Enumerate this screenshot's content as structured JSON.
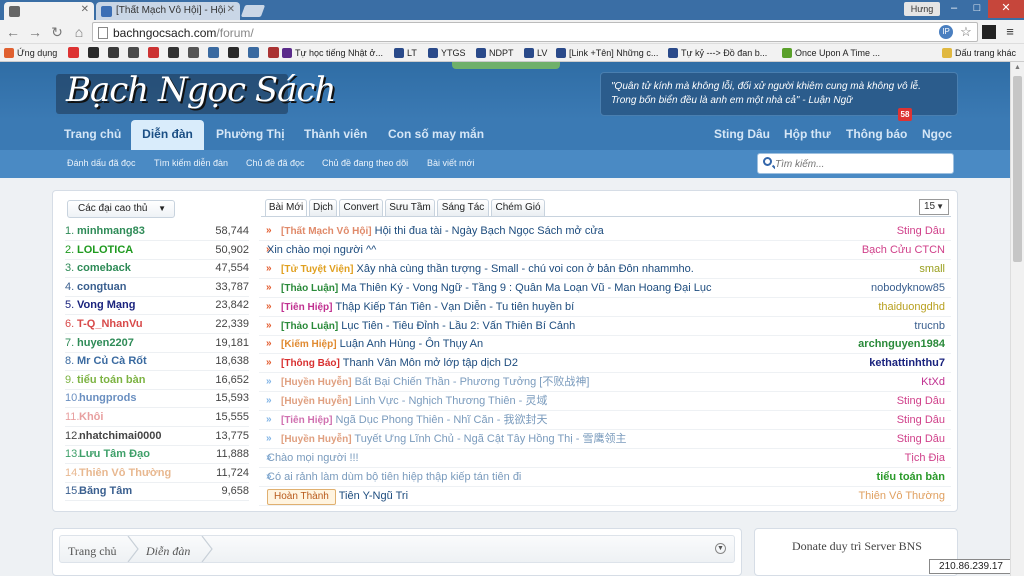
{
  "browser": {
    "tabs": [
      {
        "label": "",
        "active": true
      },
      {
        "label": "[Thất Mạch Vô Hội] - Hội",
        "active": false
      }
    ],
    "user": "Hưng",
    "url_domain": "bachngocsach.com",
    "url_path": "/forum/",
    "bookmarks": [
      "Ứng dụng",
      "Tự học tiếng Nhật ở...",
      "LT",
      "YTGS",
      "NDPT",
      "LV",
      "[Link +Tên] Những c...",
      "Tự kỷ ---> Đồ đan b...",
      "Once Upon A Time ...",
      "Dấu trang khác"
    ]
  },
  "site": {
    "logo": "Bạch Ngọc Sách",
    "quote_line1": "\"Quân tử kính mà không lỗi, đối xử người khiêm cung mà không vô lễ.",
    "quote_line2": "Trong bốn biển đều là anh em một nhà cả\" - Luận Ngữ",
    "nav_left": [
      "Trang chủ",
      "Diễn đàn",
      "Phường Thị",
      "Thành viên",
      "Con số may mắn"
    ],
    "nav_right": [
      "Sting Dâu",
      "Hộp thư",
      "Thông báo",
      "Ngọc"
    ],
    "notification_count": "58",
    "subnav": [
      "Đánh dấu đã đọc",
      "Tìm kiếm diễn đàn",
      "Chủ đề đã đọc",
      "Chủ đề đang theo dõi",
      "Bài viết mới"
    ],
    "search_placeholder": "Tìm kiếm..."
  },
  "leaderboard": {
    "dropdown": "Các đại cao thủ",
    "entries": [
      {
        "rank": "1.",
        "name": "minhmang83",
        "points": "58,744",
        "color": "#2e8b57"
      },
      {
        "rank": "2.",
        "name": "LOLOTICA",
        "points": "50,902",
        "color": "#1f9a1f"
      },
      {
        "rank": "3.",
        "name": "comeback",
        "points": "47,554",
        "color": "#2e8b57"
      },
      {
        "rank": "4.",
        "name": "congtuan",
        "points": "33,787",
        "color": "#3a5f8f"
      },
      {
        "rank": "5.",
        "name": "Vong Mạng",
        "points": "23,842",
        "color": "#1a237e"
      },
      {
        "rank": "6.",
        "name": "T-Q_NhanVu",
        "points": "22,339",
        "color": "#d84a4a"
      },
      {
        "rank": "7.",
        "name": "huyen2207",
        "points": "19,181",
        "color": "#2e8b57"
      },
      {
        "rank": "8.",
        "name": "Mr Củ Cà Rốt",
        "points": "18,638",
        "color": "#3a6aa0"
      },
      {
        "rank": "9.",
        "name": "tiểu toán bàn",
        "points": "16,652",
        "color": "#7cb342"
      },
      {
        "rank": "10.",
        "name": "hungprods",
        "points": "15,593",
        "color": "#6a8fc0"
      },
      {
        "rank": "11.",
        "name": "Khôi",
        "points": "15,555",
        "color": "#e8a0a0"
      },
      {
        "rank": "12.",
        "name": "nhatchimai0000",
        "points": "13,775",
        "color": "#444444"
      },
      {
        "rank": "13.",
        "name": "Lưu Tâm Đạo",
        "points": "11,888",
        "color": "#3fa06a"
      },
      {
        "rank": "14.",
        "name": "Thiên Vô Thường",
        "points": "11,724",
        "color": "#e8b890"
      },
      {
        "rank": "15.",
        "name": "Băng Tâm",
        "points": "9,658",
        "color": "#3a5f8f"
      }
    ]
  },
  "topics": {
    "tabs": [
      "Bài Mới",
      "Dịch",
      "Convert",
      "Sưu Tầm",
      "Sáng Tác",
      "Chém Gió"
    ],
    "page_size": "15",
    "rows": [
      {
        "cat": "[Thất Mạch Vô Hội]",
        "cat_color": "#e08a6a",
        "title": "Hội thi đua tài - Ngày Bạch Ngọc Sách mở cửa",
        "user": "Sting Dâu",
        "user_color": "#d0408a",
        "fade": false,
        "tag": ""
      },
      {
        "cat": "",
        "cat_color": "",
        "title": "Xin chào mọi người ^^",
        "user": "Bạch Cửu CTCN",
        "user_color": "#d0408a",
        "fade": false,
        "tag": ""
      },
      {
        "cat": "[Tử Tuyệt Viện]",
        "cat_color": "#e0a020",
        "title": "Xây nhà cùng thần tượng - Small - chú voi con ở bản Đôn nhammho.",
        "user": "small",
        "user_color": "#9aa020",
        "fade": false,
        "tag": ""
      },
      {
        "cat": "[Thảo Luận]",
        "cat_color": "#2a8a3a",
        "title": "Ma Thiên Ký - Vong Ngữ - Tầng 9 : Quân Ma Loạn Vũ - Man Hoang Đại Lục",
        "user": "nobodyknow85",
        "user_color": "#3a5f8f",
        "fade": false,
        "tag": ""
      },
      {
        "cat": "[Tiên Hiệp]",
        "cat_color": "#c03090",
        "title": "Thập Kiếp Tán Tiên - Vạn Diễn - Tu tiên huyền bí",
        "user": "thaiduongdhd",
        "user_color": "#b8a020",
        "fade": false,
        "tag": ""
      },
      {
        "cat": "[Thảo Luận]",
        "cat_color": "#2a8a3a",
        "title": "Lục Tiên - Tiêu Đỉnh - Lầu 2: Vấn Thiên Bí Cảnh",
        "user": "trucnb",
        "user_color": "#3a5f8f",
        "fade": false,
        "tag": ""
      },
      {
        "cat": "[Kiếm Hiệp]",
        "cat_color": "#e08a30",
        "title": "Luận Anh Hùng - Ôn Thụy An",
        "user": "archnguyen1984",
        "user_color": "#2a8a3a",
        "fade": false,
        "tag": ""
      },
      {
        "cat": "[Thông Báo]",
        "cat_color": "#d83030",
        "title": "Thanh Vân Môn mở lớp tập dịch D2",
        "user": "kethattinhthu7",
        "user_color": "#1a237e",
        "fade": false,
        "tag": ""
      },
      {
        "cat": "[Huyền Huyễn]",
        "cat_color": "#e0a080",
        "title": "Bất Bại Chiến Thần - Phương Tưởng [不败战神]",
        "user": "KtXd",
        "user_color": "#c03090",
        "fade": true,
        "tag": ""
      },
      {
        "cat": "[Huyền Huyễn]",
        "cat_color": "#e0a080",
        "title": "Linh Vực - Nghịch Thương Thiên - 灵域",
        "user": "Sting Dâu",
        "user_color": "#d0408a",
        "fade": true,
        "tag": ""
      },
      {
        "cat": "[Tiên Hiệp]",
        "cat_color": "#d070b0",
        "title": "Ngã Dục Phong Thiên - Nhĩ Căn - 我欲封天",
        "user": "Sting Dâu",
        "user_color": "#d0408a",
        "fade": true,
        "tag": ""
      },
      {
        "cat": "[Huyền Huyễn]",
        "cat_color": "#e0a080",
        "title": "Tuyết Ưng Lĩnh Chủ - Ngã Cật Tây Hồng Thị - 雪鹰领主",
        "user": "Sting Dâu",
        "user_color": "#d0408a",
        "fade": true,
        "tag": ""
      },
      {
        "cat": "",
        "cat_color": "",
        "title": "Chào mọi người !!!",
        "user": "Tịch Địa",
        "user_color": "#d0408a",
        "fade": true,
        "tag": ""
      },
      {
        "cat": "",
        "cat_color": "",
        "title": "Có ai rảnh làm dùm bộ tiên hiệp thập kiếp tán tiên đi",
        "user": "tiểu toán bàn",
        "user_color": "#2a9a2a",
        "fade": true,
        "tag": ""
      },
      {
        "cat": "",
        "cat_color": "",
        "title": "Tiên Y-Ngũ Tri",
        "user": "Thiên Vô Thường",
        "user_color": "#e0a060",
        "fade": false,
        "tag": "Hoàn Thành"
      }
    ]
  },
  "breadcrumb": [
    "Trang chủ",
    "Diễn đàn"
  ],
  "donate_title": "Donate duy trì Server BNS",
  "ip_address": "210.86.239.17"
}
